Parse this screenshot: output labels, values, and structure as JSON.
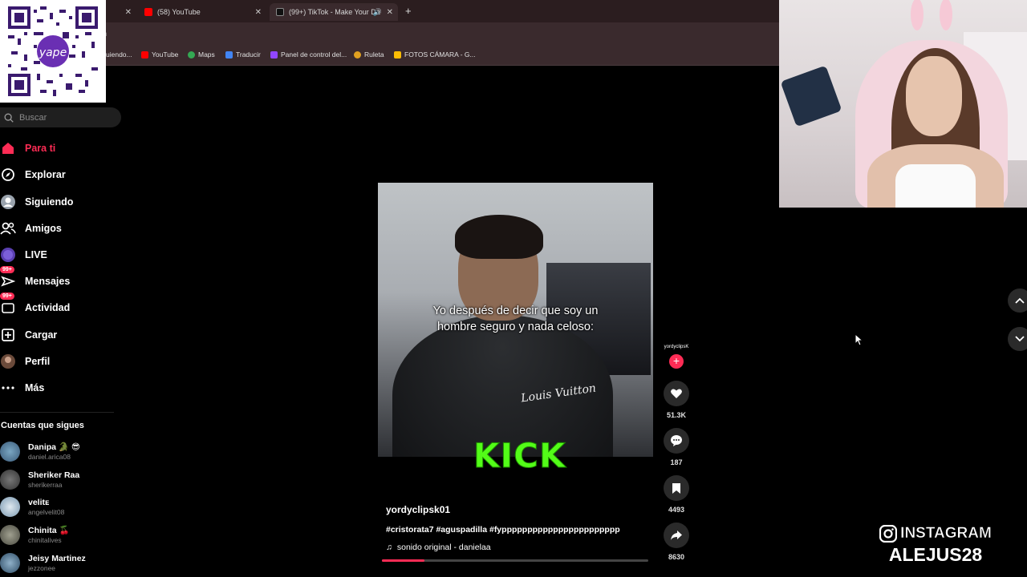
{
  "browser": {
    "tabs": [
      {
        "label": "",
        "active": false
      },
      {
        "label": "(58) YouTube",
        "active": false
      },
      {
        "label": "(99+) TikTok - Make Your Da",
        "active": true
      }
    ],
    "url": "n",
    "bookmarks": [
      {
        "label": "uiendo...",
        "color": "#888"
      },
      {
        "label": "YouTube",
        "color": "#ff0000"
      },
      {
        "label": "Maps",
        "color": "#34a853"
      },
      {
        "label": "Traducir",
        "color": "#4285f4"
      },
      {
        "label": "Panel de control del...",
        "color": "#9146ff"
      },
      {
        "label": "Ruleta",
        "color": "#e0a020"
      },
      {
        "label": "FOTOS CÁMARA - G...",
        "color": "#fbbc04"
      }
    ]
  },
  "sidebar": {
    "search_placeholder": "Buscar",
    "items": [
      {
        "label": "Para ti",
        "icon": "home-icon"
      },
      {
        "label": "Explorar",
        "icon": "compass-icon"
      },
      {
        "label": "Siguiendo",
        "icon": "following-icon"
      },
      {
        "label": "Amigos",
        "icon": "friends-icon"
      },
      {
        "label": "LIVE",
        "icon": "live-icon"
      },
      {
        "label": "Mensajes",
        "icon": "messages-icon",
        "badge": "99+"
      },
      {
        "label": "Actividad",
        "icon": "activity-icon",
        "badge": "99+"
      },
      {
        "label": "Cargar",
        "icon": "upload-icon"
      },
      {
        "label": "Perfil",
        "icon": "profile-icon"
      },
      {
        "label": "Más",
        "icon": "more-icon"
      }
    ],
    "following_title": "Cuentas que sigues",
    "accounts": [
      {
        "name": "Danipa 🐊 😎",
        "handle": "daniel.arica08"
      },
      {
        "name": "Sheriker Raa",
        "handle": "sherikerraa"
      },
      {
        "name": "velitᴇ",
        "handle": "angelvelit08"
      },
      {
        "name": "Chinita 🍒",
        "handle": "chinitalives"
      },
      {
        "name": "Jeisy Martinez",
        "handle": "jezzonee"
      }
    ]
  },
  "video": {
    "caption_line1": "Yo después de decir que soy un",
    "caption_line2": "hombre seguro y nada celoso:",
    "jacket_text": "Louis Vuitton",
    "overlay_logo": "KICK",
    "username": "yordyclipsk01",
    "tags": "#cristorata7 #aguspadilla #fyppppppppppppppppppppppp",
    "sound": "sonido original - danielaa",
    "progress": 0.16
  },
  "actions": {
    "avatar_label": "yordyclipsK",
    "likes": "51.3K",
    "comments": "187",
    "saves": "4493",
    "shares": "8630"
  },
  "overlay": {
    "instagram_label": "INSTAGRAM",
    "handle": "ALEJUS28"
  },
  "colors": {
    "accent": "#fe2c55",
    "kick": "#53fc18"
  }
}
